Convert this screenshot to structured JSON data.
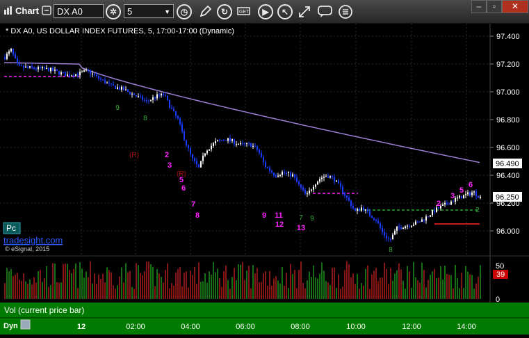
{
  "toolbar": {
    "chart_label": "Chart",
    "symbol_value": "DX A0",
    "interval_value": "5",
    "icons": [
      "chart-icon",
      "link-icon",
      "settings-icon",
      "dropdown-icon",
      "clock-icon",
      "pencil-icon",
      "refresh-icon",
      "template-icon",
      "play-icon",
      "cursor-icon",
      "crosshair-icon",
      "comment-icon",
      "menu-icon",
      "minimize-icon",
      "maximize-icon",
      "close-icon"
    ]
  },
  "chart": {
    "title": "* DX A0, US DOLLAR INDEX FUTURES, 5, 17:00-17:00 (Dynamic)",
    "pc_label": "Pc",
    "watermark": "tradesight.com",
    "copyright": "© eSignal, 2015",
    "price_ticks": [
      "97.400",
      "97.200",
      "97.000",
      "96.800",
      "96.600",
      "96.400",
      "96.200",
      "96.000"
    ],
    "ma_label": "96.490",
    "last_label": "96.250",
    "time_ticks": [
      "12",
      "02:00",
      "04:00",
      "06:00",
      "08:00",
      "10:00",
      "12:00",
      "14:00"
    ],
    "vol_label": "Vol (current price bar)",
    "vol_ticks": [
      "50",
      "0"
    ],
    "vol_value": "39",
    "dyn_label": "Dyn",
    "annotations": {
      "magenta": [
        "2",
        "3",
        "5",
        "6",
        "7",
        "8",
        "9",
        "11",
        "12",
        "13",
        "2",
        "3",
        "5",
        "6"
      ],
      "red": [
        "(R)",
        "(R)"
      ],
      "green": [
        "9",
        "8",
        "7",
        "9",
        "8",
        "2"
      ]
    }
  },
  "colors": {
    "up_bar": "#ffffff",
    "down_bar": "#1a3cff",
    "ma": "#9b7fd6",
    "magenta": "#ff22ff",
    "vol_green": "#22aa22",
    "vol_red": "#cc2222",
    "price_label_bg": "#ffffff",
    "vol_label_bg": "#cc0000",
    "axis_bg": "#007a00"
  },
  "chart_data": {
    "type": "candlestick",
    "y_range": [
      95.8,
      97.5
    ],
    "moving_average": {
      "end_value": 96.49
    },
    "levels": [
      {
        "value": 97.11,
        "color": "magenta",
        "style": "dashed"
      },
      {
        "value": 96.27,
        "color": "magenta",
        "style": "dashed"
      },
      {
        "value": 96.15,
        "color": "green",
        "style": "dashed"
      },
      {
        "value": 96.05,
        "color": "red",
        "style": "solid"
      }
    ],
    "last_price": 96.25,
    "volume_ylim": [
      0,
      60
    ],
    "volume_last": 39
  }
}
